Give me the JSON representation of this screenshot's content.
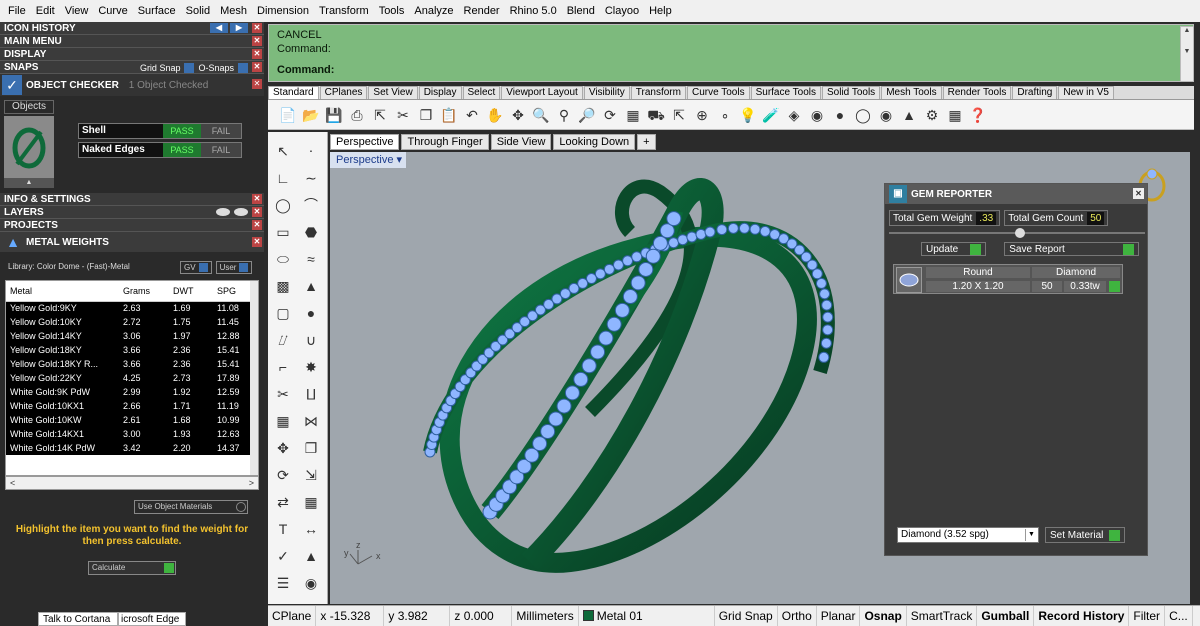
{
  "menubar": [
    "File",
    "Edit",
    "View",
    "Curve",
    "Surface",
    "Solid",
    "Mesh",
    "Dimension",
    "Transform",
    "Tools",
    "Analyze",
    "Render",
    "Rhino 5.0",
    "Blend",
    "Clayoo",
    "Help"
  ],
  "left": {
    "icon_history": "ICON HISTORY",
    "main_menu": "MAIN MENU",
    "display": "DISPLAY",
    "snaps": "SNAPS",
    "grid_snap": "Grid Snap",
    "o_snaps": "O-Snaps",
    "object_checker": "OBJECT CHECKER",
    "objects_checked": "1 Object Checked",
    "objects_label": "Objects",
    "checks": [
      {
        "name": "Shell",
        "pass": "PASS",
        "fail": "FAIL"
      },
      {
        "name": "Naked Edges",
        "pass": "PASS",
        "fail": "FAIL"
      }
    ],
    "info_settings": "INFO & SETTINGS",
    "layers": "LAYERS",
    "projects": "PROJECTS",
    "metal_weights": "METAL WEIGHTS",
    "library": "Library: Color Dome - (Fast)-Metal",
    "gv_label": "GV",
    "user_label": "User",
    "table_headers": [
      "Metal",
      "Grams",
      "DWT",
      "SPG"
    ],
    "table_rows": [
      [
        "Yellow Gold:9KY",
        "2.63",
        "1.69",
        "11.08"
      ],
      [
        "Yellow Gold:10KY",
        "2.72",
        "1.75",
        "11.45"
      ],
      [
        "Yellow Gold:14KY",
        "3.06",
        "1.97",
        "12.88"
      ],
      [
        "Yellow Gold:18KY",
        "3.66",
        "2.36",
        "15.41"
      ],
      [
        "Yellow Gold:18KY R...",
        "3.66",
        "2.36",
        "15.41"
      ],
      [
        "Yellow Gold:22KY",
        "4.25",
        "2.73",
        "17.89"
      ],
      [
        "White Gold:9K PdW",
        "2.99",
        "1.92",
        "12.59"
      ],
      [
        "White Gold:10KX1",
        "2.66",
        "1.71",
        "11.19"
      ],
      [
        "White Gold:10KW",
        "2.61",
        "1.68",
        "10.99"
      ],
      [
        "White Gold:14KX1",
        "3.00",
        "1.93",
        "12.63"
      ],
      [
        "White Gold:14K PdW",
        "3.42",
        "2.20",
        "14.37"
      ]
    ],
    "use_object_materials": "Use Object Materials",
    "hint": "Highlight the item you want to find the weight for then press calculate.",
    "calculate": "Calculate",
    "taskbar": {
      "cortana": "Talk to Cortana",
      "edge": "icrosoft Edge"
    }
  },
  "command": {
    "cancel": "CANCEL",
    "command1": "Command:",
    "command2": "Command:"
  },
  "toolbar_tabs": [
    "Standard",
    "CPlanes",
    "Set View",
    "Display",
    "Select",
    "Viewport Layout",
    "Visibility",
    "Transform",
    "Curve Tools",
    "Surface Tools",
    "Solid Tools",
    "Mesh Tools",
    "Render Tools",
    "Drafting",
    "New in V5"
  ],
  "viewport_tabs": [
    "Perspective",
    "Through Finger",
    "Side View",
    "Looking Down",
    "+"
  ],
  "viewport_label": "Perspective",
  "axes": {
    "x": "x",
    "y": "y",
    "z": "z"
  },
  "gem_reporter": {
    "title": "GEM REPORTER",
    "total_weight_label": "Total Gem Weight",
    "total_weight": ".33",
    "total_count_label": "Total Gem Count",
    "total_count": "50",
    "update": "Update",
    "save_report": "Save Report",
    "headers": [
      "Round",
      "Diamond"
    ],
    "size": "1.20 X 1.20",
    "count": "50",
    "weight": "0.33tw",
    "material_select": "Diamond      (3.52 spg)",
    "set_material": "Set Material"
  },
  "statusbar": {
    "cplane": "CPlane",
    "x": "x -15.328",
    "y": "y 3.982",
    "z": "z 0.000",
    "units": "Millimeters",
    "layer": "Metal 01",
    "grid_snap": "Grid Snap",
    "ortho": "Ortho",
    "planar": "Planar",
    "osnap": "Osnap",
    "smarttrack": "SmartTrack",
    "gumball": "Gumball",
    "record_history": "Record History",
    "filter": "Filter",
    "more": "C..."
  },
  "colors": {
    "command_bg": "#7dba7d",
    "ring_metal": "#0e6a3a",
    "gem": "#8fb6ff",
    "layer_swatch": "#0e6a3a"
  }
}
